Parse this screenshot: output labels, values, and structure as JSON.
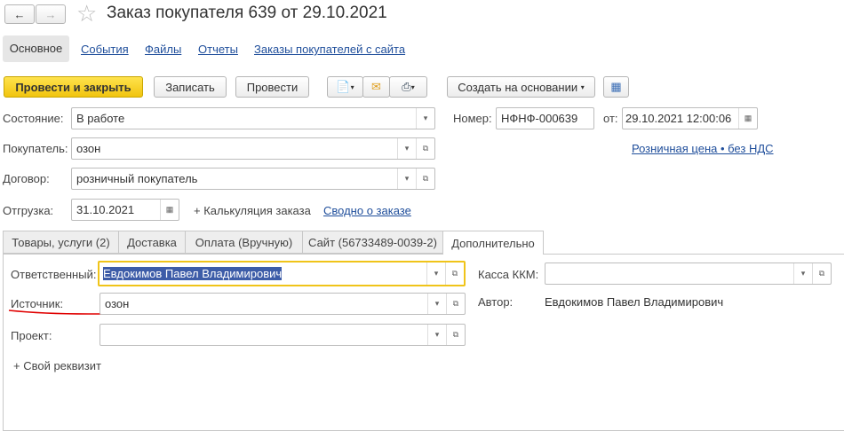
{
  "header": {
    "title": "Заказ покупателя 639 от 29.10.2021"
  },
  "nav_tabs": [
    "Основное",
    "События",
    "Файлы",
    "Отчеты",
    "Заказы покупателей с сайта"
  ],
  "toolbar": {
    "post_close": "Провести и закрыть",
    "save": "Записать",
    "post": "Провести",
    "create_based": "Создать на основании"
  },
  "form": {
    "state_label": "Состояние:",
    "state_value": "В работе",
    "number_label": "Номер:",
    "number_value": "НФНФ-000639",
    "date_label": "от:",
    "date_value": "29.10.2021 12:00:06",
    "buyer_label": "Покупатель:",
    "buyer_value": "озон",
    "price_link": "Розничная цена • без НДС",
    "contract_label": "Договор:",
    "contract_value": "розничный покупатель",
    "shipment_label": "Отгрузка:",
    "shipment_value": "31.10.2021",
    "calc_link": "+ Калькуляция заказа",
    "summary_link": "Сводно о заказе"
  },
  "tabs": [
    "Товары, услуги (2)",
    "Доставка",
    "Оплата (Вручную)",
    "Сайт (56733489-0039-2)",
    "Дополнительно"
  ],
  "extra": {
    "responsible_label": "Ответственный:",
    "responsible_value": "Евдокимов Павел Владимирович",
    "kkm_label": "Касса ККМ:",
    "kkm_value": "",
    "source_label": "Источник:",
    "source_value": "озон",
    "author_label": "Автор:",
    "author_value": "Евдокимов Павел Владимирович",
    "project_label": "Проект:",
    "project_value": "",
    "add_attr": "+ Свой реквизит"
  },
  "colors": {
    "accent": "#f1c40f",
    "link": "#1f4e9b",
    "selection": "#3d5ca8",
    "underline": "#e00000"
  }
}
